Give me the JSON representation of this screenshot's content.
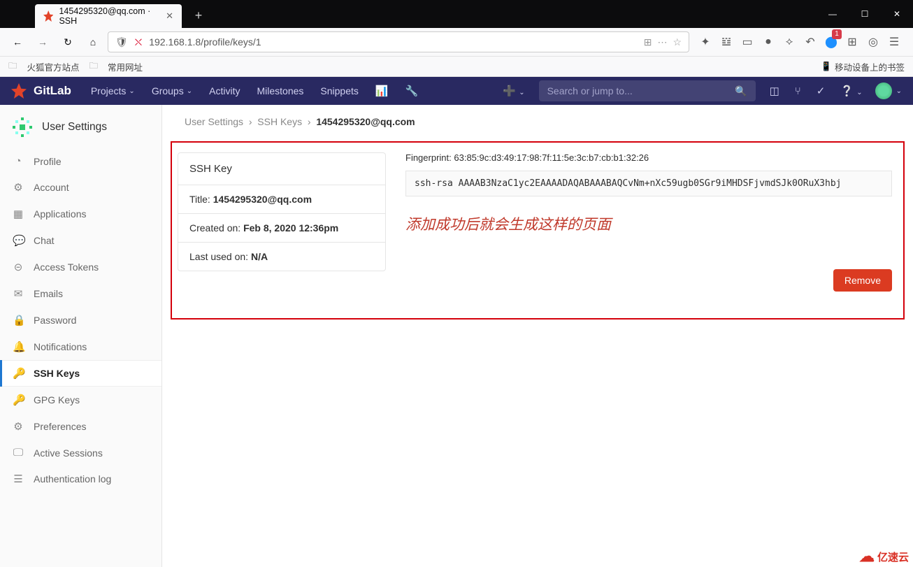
{
  "browser": {
    "tab_title": "1454295320@qq.com · SSH ",
    "tab_close": "✕",
    "newtab": "+",
    "win_min": "—",
    "win_max": "☐",
    "win_close": "✕",
    "url": "192.168.1.8/profile/keys/1",
    "bookmarks": {
      "fx": "火狐官方站点",
      "common": "常用网址",
      "mobile": "移动设备上的书签"
    },
    "toolbar_badge": "1"
  },
  "nav": {
    "brand": "GitLab",
    "projects": "Projects",
    "groups": "Groups",
    "activity": "Activity",
    "milestones": "Milestones",
    "snippets": "Snippets",
    "search_placeholder": "Search or jump to..."
  },
  "sidebar": {
    "header": "User Settings",
    "items": [
      {
        "icon": "◔",
        "label": "Profile"
      },
      {
        "icon": "⚙",
        "label": "Account"
      },
      {
        "icon": "▦",
        "label": "Applications"
      },
      {
        "icon": "💬",
        "label": "Chat"
      },
      {
        "icon": "⊝",
        "label": "Access Tokens"
      },
      {
        "icon": "✉",
        "label": "Emails"
      },
      {
        "icon": "🔒",
        "label": "Password"
      },
      {
        "icon": "🔔",
        "label": "Notifications"
      },
      {
        "icon": "🔑",
        "label": "SSH Keys",
        "active": true
      },
      {
        "icon": "🔑",
        "label": "GPG Keys"
      },
      {
        "icon": "⚙",
        "label": "Preferences"
      },
      {
        "icon": "🖵",
        "label": "Active Sessions"
      },
      {
        "icon": "☰",
        "label": "Authentication log"
      }
    ]
  },
  "crumbs": {
    "a": "User Settings",
    "b": "SSH Keys",
    "c": "1454295320@qq.com",
    "sep": "›"
  },
  "key_card": {
    "heading": "SSH Key",
    "title_label": "Title: ",
    "title_value": "1454295320@qq.com",
    "created_label": "Created on: ",
    "created_value": "Feb 8, 2020 12:36pm",
    "lastused_label": "Last used on: ",
    "lastused_value": "N/A"
  },
  "fingerprint_label": "Fingerprint: ",
  "fingerprint_value": "63:85:9c:d3:49:17:98:7f:11:5e:3c:b7:cb:b1:32:26",
  "ssh_key": "ssh-rsa AAAAB3NzaC1yc2EAAAADAQABAAABAQCvNm+nXc59ugb0SGr9iMHDSFjvmdSJk0ORuX3hbj",
  "annotation": "添加成功后就会生成这样的页面",
  "remove_btn": "Remove",
  "watermark": "亿速云"
}
